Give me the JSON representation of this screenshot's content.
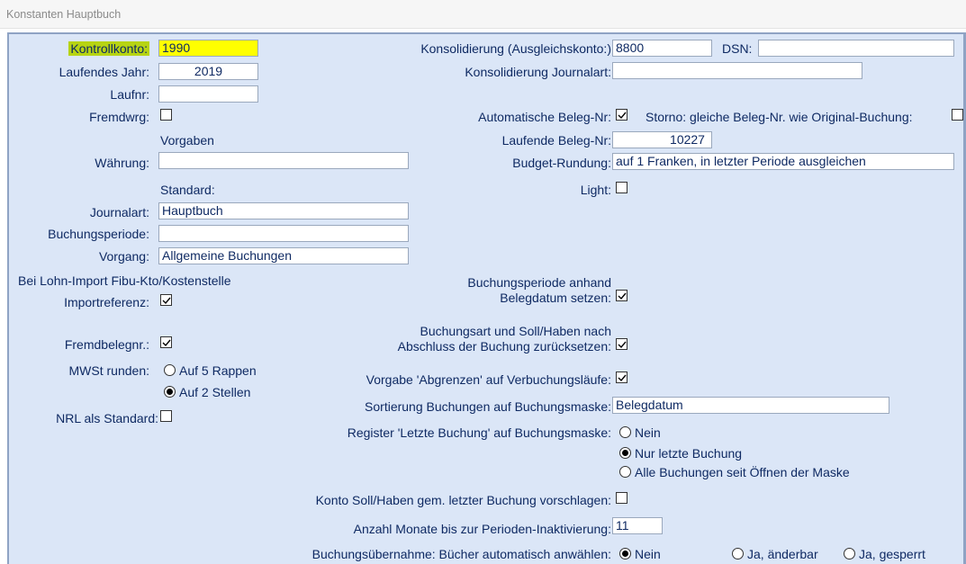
{
  "window": {
    "title": "Konstanten Hauptbuch"
  },
  "left": {
    "kontrollkonto": {
      "label": "Kontrollkonto:",
      "value": "1990"
    },
    "laufendes_jahr": {
      "label": "Laufendes Jahr:",
      "value": "2019"
    },
    "laufnr": {
      "label": "Laufnr:",
      "value": ""
    },
    "fremdwrg": {
      "label": "Fremdwrg:",
      "checked": false
    },
    "vorgaben_heading": "Vorgaben",
    "waehrung": {
      "label": "Währung:",
      "value": ""
    },
    "standard_heading": "Standard:",
    "journalart": {
      "label": "Journalart:",
      "value": "Hauptbuch"
    },
    "buchungsperiode": {
      "label": "Buchungsperiode:",
      "value": ""
    },
    "vorgang": {
      "label": "Vorgang:",
      "value": "Allgemeine Buchungen"
    },
    "lohn_import_heading": "Bei Lohn-Import Fibu-Kto/Kostenstelle",
    "importreferenz": {
      "label": "Importreferenz:",
      "checked": true
    },
    "fremdbelegnr": {
      "label": "Fremdbelegnr.:",
      "checked": true
    },
    "mwst": {
      "label": "MWSt runden:",
      "options": [
        "Auf 5 Rappen",
        "Auf 2 Stellen"
      ],
      "selected": "Auf 2 Stellen"
    },
    "nrl": {
      "label": "NRL als Standard:",
      "checked": false
    }
  },
  "right": {
    "konsolidierung_ausgleich": {
      "label": "Konsolidierung (Ausgleichskonto:)",
      "value": "8800"
    },
    "dsn": {
      "label": "DSN:",
      "value": ""
    },
    "konsolidierung_journalart": {
      "label": "Konsolidierung Journalart:",
      "value": ""
    },
    "auto_beleg_nr": {
      "label": "Automatische Beleg-Nr:",
      "checked": true
    },
    "storno": {
      "label": "Storno: gleiche Beleg-Nr. wie Original-Buchung:",
      "checked": false
    },
    "laufende_beleg_nr": {
      "label": "Laufende Beleg-Nr:",
      "value": "10227"
    },
    "budget_rundung": {
      "label": "Budget-Rundung:",
      "value": "auf 1 Franken, in letzter Periode ausgleichen"
    },
    "light": {
      "label": "Light:",
      "checked": false
    },
    "buchungsperiode_belegdatum": {
      "label_line1": "Buchungsperiode anhand",
      "label_line2": "Belegdatum setzen:",
      "checked": true
    },
    "buchungsart_reset": {
      "label_line1": "Buchungsart und Soll/Haben nach",
      "label_line2": "Abschluss der Buchung zurücksetzen:",
      "checked": true
    },
    "vorgabe_abgrenzen": {
      "label": "Vorgabe 'Abgrenzen' auf Verbuchungsläufe:",
      "checked": true
    },
    "sortierung": {
      "label": "Sortierung Buchungen auf Buchungsmaske:",
      "value": "Belegdatum"
    },
    "register_letzte": {
      "label": "Register 'Letzte Buchung' auf Buchungsmaske:",
      "options": [
        "Nein",
        "Nur letzte Buchung",
        "Alle Buchungen seit Öffnen der Maske"
      ],
      "selected": "Nur letzte Buchung"
    },
    "konto_soll_haben": {
      "label": "Konto Soll/Haben gem. letzter Buchung vorschlagen:",
      "checked": false
    },
    "anzahl_monate": {
      "label": "Anzahl Monate bis zur Perioden-Inaktivierung:",
      "value": "11"
    },
    "buchungsuebernahme": {
      "label": "Buchungsübernahme: Bücher automatisch anwählen:",
      "options": [
        "Nein",
        "Ja, änderbar",
        "Ja, gesperrt"
      ],
      "selected": "Nein"
    }
  },
  "colors": {
    "panel_bg": "#dbe6f7",
    "text": "#0f2a63",
    "highlight_label": "#b7d413",
    "highlight_field": "#ffff00"
  }
}
